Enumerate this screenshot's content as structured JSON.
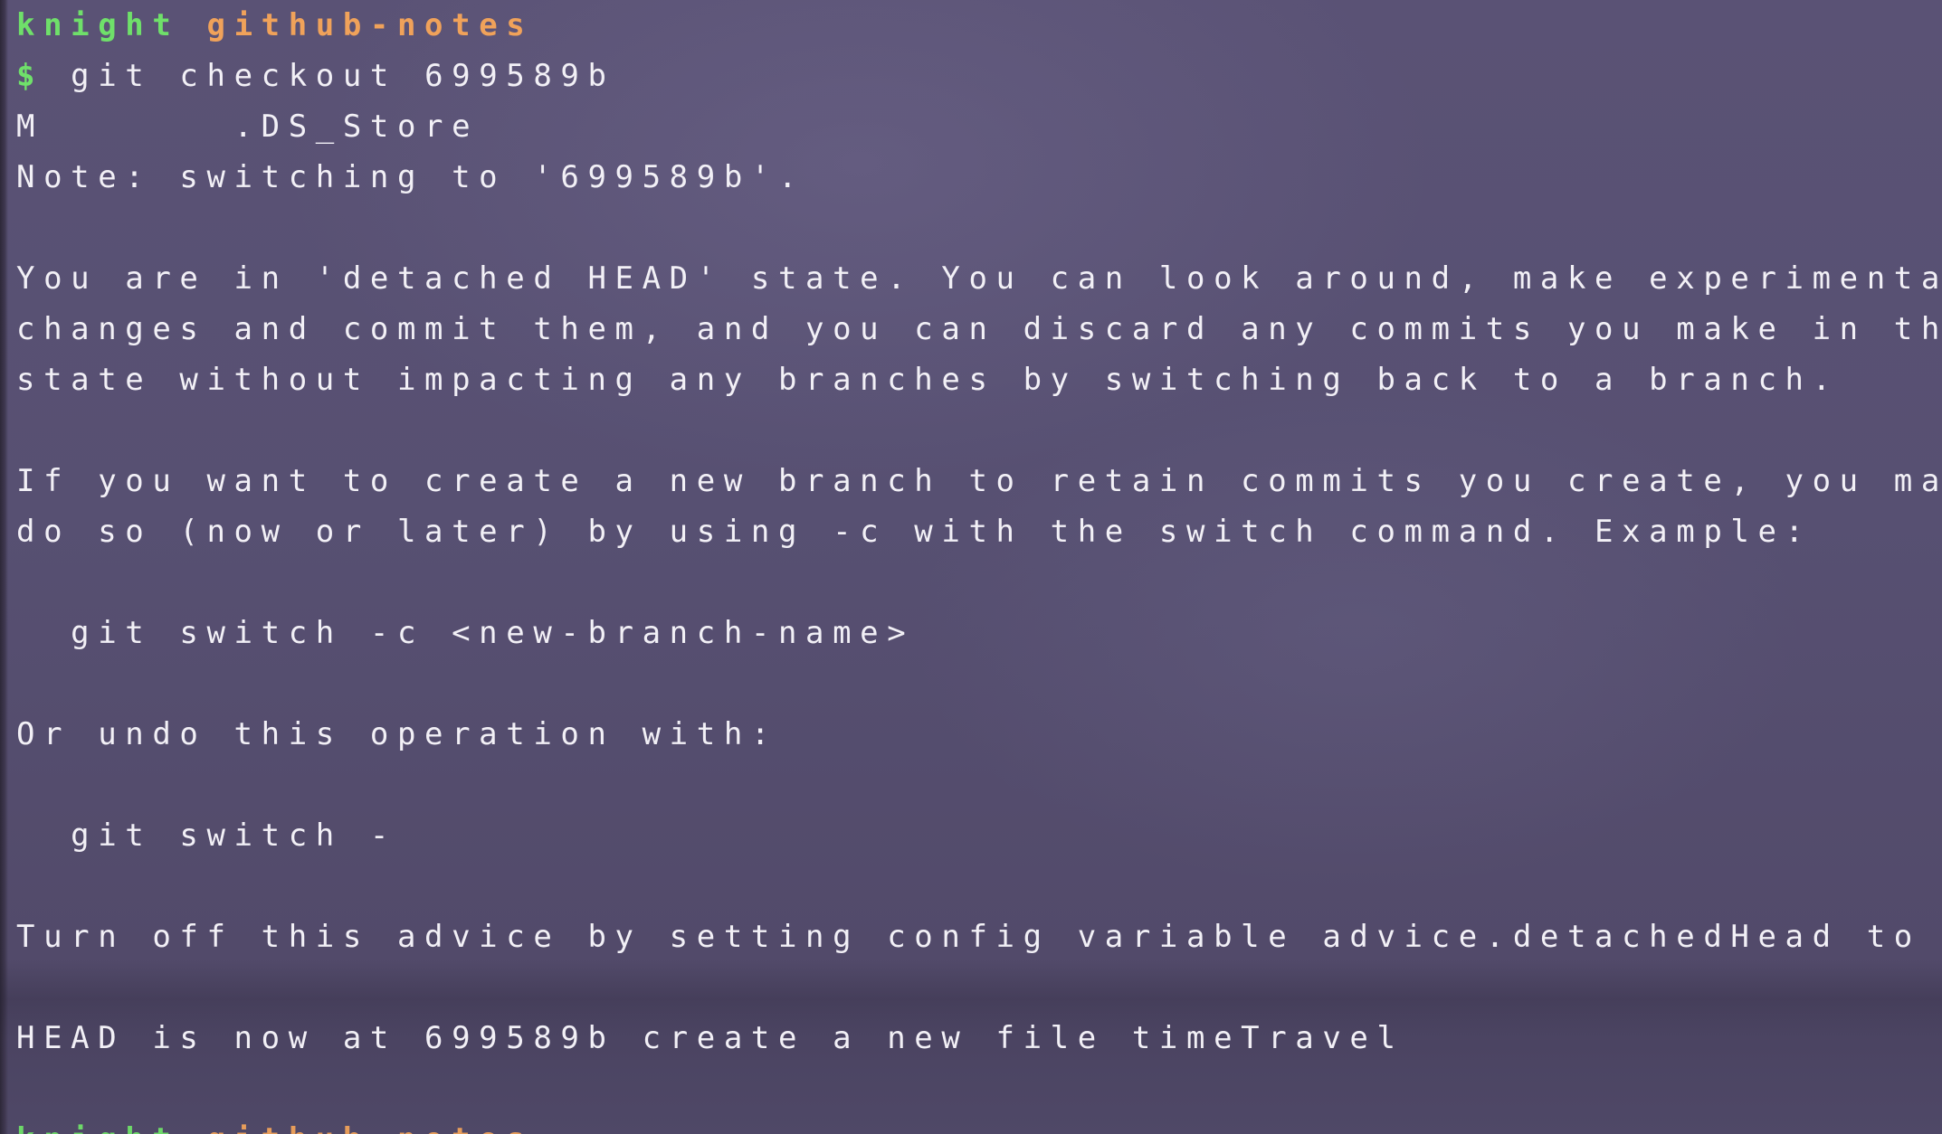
{
  "prompt": {
    "user": "knight",
    "directory": "github-notes",
    "symbol": "$",
    "command": "git checkout 699589b"
  },
  "output": [
    "M       .DS_Store",
    "Note: switching to '699589b'.",
    "",
    "You are in 'detached HEAD' state. You can look around, make experimental",
    "changes and commit them, and you can discard any commits you make in this",
    "state without impacting any branches by switching back to a branch.",
    "",
    "If you want to create a new branch to retain commits you create, you may",
    "do so (now or later) by using -c with the switch command. Example:",
    "",
    "  git switch -c <new-branch-name>",
    "",
    "Or undo this operation with:",
    "",
    "  git switch -",
    "",
    "Turn off this advice by setting config variable advice.detachedHead to false",
    "",
    "HEAD is now at 699589b create a new file timeTravel",
    ""
  ],
  "next_prompt": {
    "user": "knight",
    "directory": "github-notes"
  },
  "colors": {
    "background": "#574f6e",
    "text": "#f2f0f6",
    "user": "#6fe06a",
    "directory": "#f0a25a"
  }
}
